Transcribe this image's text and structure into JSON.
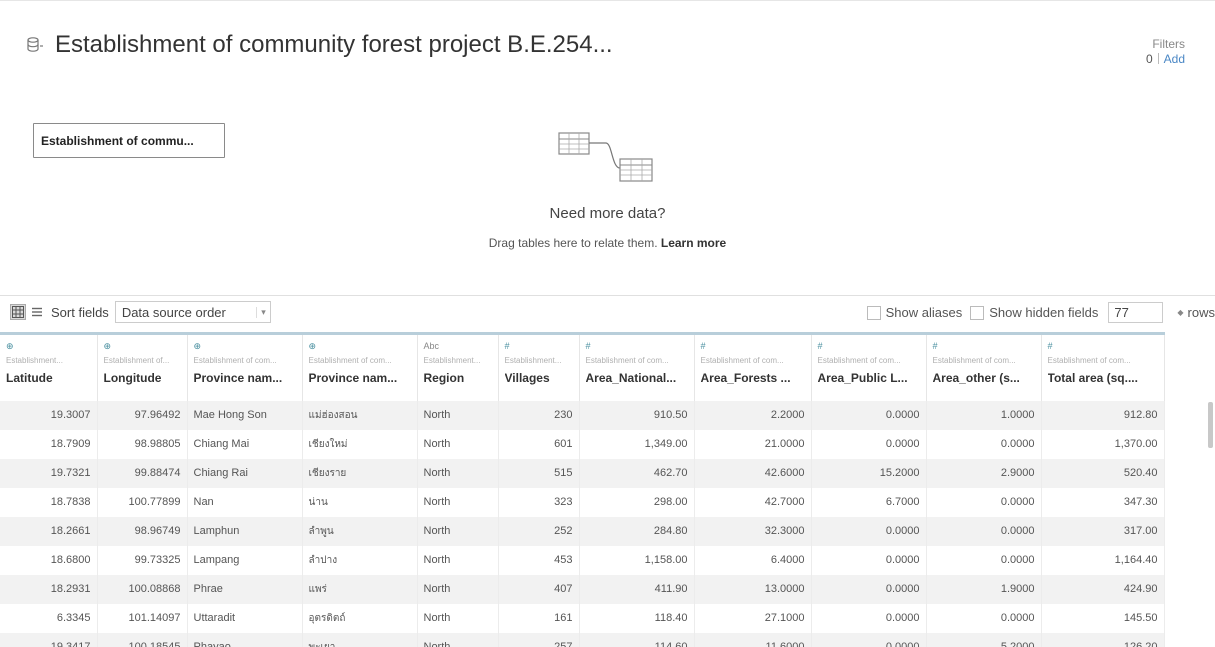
{
  "header": {
    "title": "Establishment of community forest project B.E.254...",
    "filters_label": "Filters",
    "filters_count": "0",
    "filters_add": "Add"
  },
  "canvas": {
    "table_card_label": "Establishment of commu...",
    "need_more": "Need more data?",
    "drag_text": "Drag tables here to relate them.",
    "learn_more": "Learn more"
  },
  "toolbar": {
    "sort_label": "Sort fields",
    "sort_value": "Data source order",
    "show_aliases": "Show aliases",
    "show_hidden": "Show hidden fields",
    "rows_value": "77",
    "rows_label": "rows"
  },
  "grid": {
    "columns": [
      {
        "type_icon": "globe-icon",
        "type_glyph": "⊕",
        "source": "Establishment...",
        "name": "Latitude"
      },
      {
        "type_icon": "globe-icon",
        "type_glyph": "⊕",
        "source": "Establishment of...",
        "name": "Longitude"
      },
      {
        "type_icon": "globe-icon",
        "type_glyph": "⊕",
        "source": "Establishment of com...",
        "name": "Province nam..."
      },
      {
        "type_icon": "globe-icon",
        "type_glyph": "⊕",
        "source": "Establishment of com...",
        "name": "Province nam..."
      },
      {
        "type_icon": "text-icon",
        "type_glyph": "Abc",
        "source": "Establishment...",
        "name": "Region"
      },
      {
        "type_icon": "number-icon",
        "type_glyph": "#",
        "source": "Establishment...",
        "name": "Villages"
      },
      {
        "type_icon": "number-icon",
        "type_glyph": "#",
        "source": "Establishment of com...",
        "name": "Area_National..."
      },
      {
        "type_icon": "number-icon",
        "type_glyph": "#",
        "source": "Establishment of com...",
        "name": "Area_Forests ..."
      },
      {
        "type_icon": "number-icon",
        "type_glyph": "#",
        "source": "Establishment of com...",
        "name": "Area_Public L..."
      },
      {
        "type_icon": "number-icon",
        "type_glyph": "#",
        "source": "Establishment of com...",
        "name": "Area_other (s..."
      },
      {
        "type_icon": "number-icon",
        "type_glyph": "#",
        "source": "Establishment of com...",
        "name": "Total area (sq...."
      }
    ],
    "rows": [
      [
        "19.3007",
        "97.96492",
        "Mae Hong Son",
        "แม่ฮ่องสอน",
        "North",
        "230",
        "910.50",
        "2.2000",
        "0.0000",
        "1.0000",
        "912.80"
      ],
      [
        "18.7909",
        "98.98805",
        "Chiang Mai",
        "เชียงใหม่",
        "North",
        "601",
        "1,349.00",
        "21.0000",
        "0.0000",
        "0.0000",
        "1,370.00"
      ],
      [
        "19.7321",
        "99.88474",
        "Chiang Rai",
        "เชียงราย",
        "North",
        "515",
        "462.70",
        "42.6000",
        "15.2000",
        "2.9000",
        "520.40"
      ],
      [
        "18.7838",
        "100.77899",
        "Nan",
        "น่าน",
        "North",
        "323",
        "298.00",
        "42.7000",
        "6.7000",
        "0.0000",
        "347.30"
      ],
      [
        "18.2661",
        "98.96749",
        "Lamphun",
        "ลำพูน",
        "North",
        "252",
        "284.80",
        "32.3000",
        "0.0000",
        "0.0000",
        "317.00"
      ],
      [
        "18.6800",
        "99.73325",
        "Lampang",
        "ลำปาง",
        "North",
        "453",
        "1,158.00",
        "6.4000",
        "0.0000",
        "0.0000",
        "1,164.40"
      ],
      [
        "18.2931",
        "100.08868",
        "Phrae",
        "แพร่",
        "North",
        "407",
        "411.90",
        "13.0000",
        "0.0000",
        "1.9000",
        "424.90"
      ],
      [
        "6.3345",
        "101.14097",
        "Uttaradit",
        "อุตรดิตถ์",
        "North",
        "161",
        "118.40",
        "27.1000",
        "0.0000",
        "0.0000",
        "145.50"
      ],
      [
        "19.3417",
        "100.18545",
        "Phayao",
        "พะเยา",
        "North",
        "257",
        "114.60",
        "11.6000",
        "0.0000",
        "5.2000",
        "126.20"
      ]
    ]
  }
}
